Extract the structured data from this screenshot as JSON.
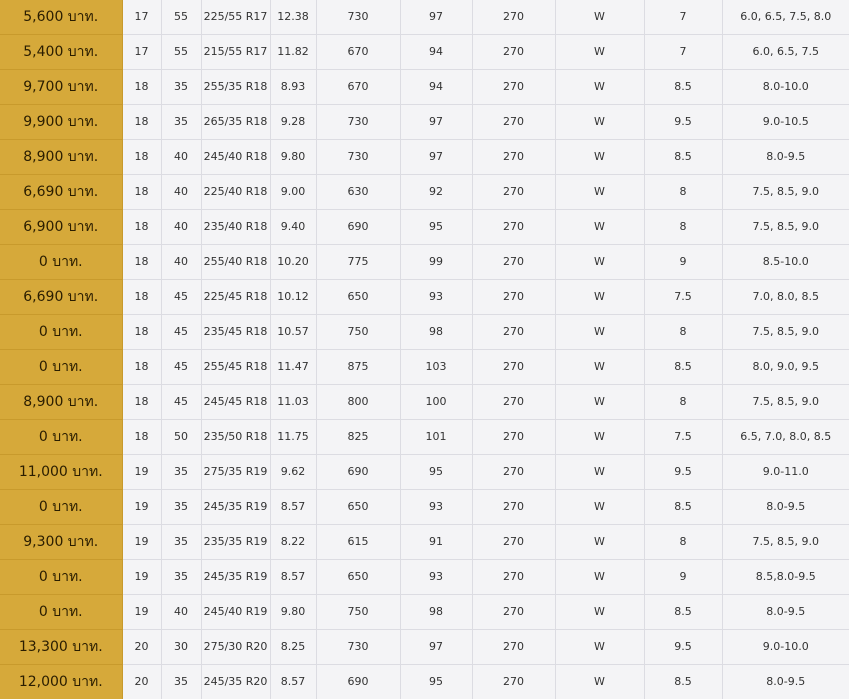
{
  "table": {
    "rows": [
      {
        "price": "5,600 บาท.",
        "rim": "17",
        "aspect": "55",
        "size": "225/55 R17",
        "weight": "12.38",
        "load_kg": "730",
        "load_index": "97",
        "speed_kmh": "270",
        "speed_symbol": "W",
        "rim_width": "7",
        "rim_range": "6.0, 6.5, 7.5, 8.0"
      },
      {
        "price": "5,400 บาท.",
        "rim": "17",
        "aspect": "55",
        "size": "215/55 R17",
        "weight": "11.82",
        "load_kg": "670",
        "load_index": "94",
        "speed_kmh": "270",
        "speed_symbol": "W",
        "rim_width": "7",
        "rim_range": "6.0, 6.5, 7.5"
      },
      {
        "price": "9,700 บาท.",
        "rim": "18",
        "aspect": "35",
        "size": "255/35 R18",
        "weight": "8.93",
        "load_kg": "670",
        "load_index": "94",
        "speed_kmh": "270",
        "speed_symbol": "W",
        "rim_width": "8.5",
        "rim_range": "8.0-10.0"
      },
      {
        "price": "9,900 บาท.",
        "rim": "18",
        "aspect": "35",
        "size": "265/35 R18",
        "weight": "9.28",
        "load_kg": "730",
        "load_index": "97",
        "speed_kmh": "270",
        "speed_symbol": "W",
        "rim_width": "9.5",
        "rim_range": "9.0-10.5"
      },
      {
        "price": "8,900 บาท.",
        "rim": "18",
        "aspect": "40",
        "size": "245/40 R18",
        "weight": "9.80",
        "load_kg": "730",
        "load_index": "97",
        "speed_kmh": "270",
        "speed_symbol": "W",
        "rim_width": "8.5",
        "rim_range": "8.0-9.5"
      },
      {
        "price": "6,690 บาท.",
        "rim": "18",
        "aspect": "40",
        "size": "225/40 R18",
        "weight": "9.00",
        "load_kg": "630",
        "load_index": "92",
        "speed_kmh": "270",
        "speed_symbol": "W",
        "rim_width": "8",
        "rim_range": "7.5, 8.5, 9.0"
      },
      {
        "price": "6,900 บาท.",
        "rim": "18",
        "aspect": "40",
        "size": "235/40 R18",
        "weight": "9.40",
        "load_kg": "690",
        "load_index": "95",
        "speed_kmh": "270",
        "speed_symbol": "W",
        "rim_width": "8",
        "rim_range": "7.5, 8.5, 9.0"
      },
      {
        "price": "0 บาท.",
        "rim": "18",
        "aspect": "40",
        "size": "255/40 R18",
        "weight": "10.20",
        "load_kg": "775",
        "load_index": "99",
        "speed_kmh": "270",
        "speed_symbol": "W",
        "rim_width": "9",
        "rim_range": "8.5-10.0"
      },
      {
        "price": "6,690 บาท.",
        "rim": "18",
        "aspect": "45",
        "size": "225/45 R18",
        "weight": "10.12",
        "load_kg": "650",
        "load_index": "93",
        "speed_kmh": "270",
        "speed_symbol": "W",
        "rim_width": "7.5",
        "rim_range": "7.0, 8.0, 8.5"
      },
      {
        "price": "0 บาท.",
        "rim": "18",
        "aspect": "45",
        "size": "235/45 R18",
        "weight": "10.57",
        "load_kg": "750",
        "load_index": "98",
        "speed_kmh": "270",
        "speed_symbol": "W",
        "rim_width": "8",
        "rim_range": "7.5, 8.5, 9.0"
      },
      {
        "price": "0 บาท.",
        "rim": "18",
        "aspect": "45",
        "size": "255/45 R18",
        "weight": "11.47",
        "load_kg": "875",
        "load_index": "103",
        "speed_kmh": "270",
        "speed_symbol": "W",
        "rim_width": "8.5",
        "rim_range": "8.0, 9.0, 9.5"
      },
      {
        "price": "8,900 บาท.",
        "rim": "18",
        "aspect": "45",
        "size": "245/45 R18",
        "weight": "11.03",
        "load_kg": "800",
        "load_index": "100",
        "speed_kmh": "270",
        "speed_symbol": "W",
        "rim_width": "8",
        "rim_range": "7.5, 8.5, 9.0"
      },
      {
        "price": "0 บาท.",
        "rim": "18",
        "aspect": "50",
        "size": "235/50 R18",
        "weight": "11.75",
        "load_kg": "825",
        "load_index": "101",
        "speed_kmh": "270",
        "speed_symbol": "W",
        "rim_width": "7.5",
        "rim_range": "6.5, 7.0, 8.0, 8.5"
      },
      {
        "price": "11,000 บาท.",
        "rim": "19",
        "aspect": "35",
        "size": "275/35 R19",
        "weight": "9.62",
        "load_kg": "690",
        "load_index": "95",
        "speed_kmh": "270",
        "speed_symbol": "W",
        "rim_width": "9.5",
        "rim_range": "9.0-11.0"
      },
      {
        "price": "0 บาท.",
        "rim": "19",
        "aspect": "35",
        "size": "245/35 R19",
        "weight": "8.57",
        "load_kg": "650",
        "load_index": "93",
        "speed_kmh": "270",
        "speed_symbol": "W",
        "rim_width": "8.5",
        "rim_range": "8.0-9.5"
      },
      {
        "price": "9,300 บาท.",
        "rim": "19",
        "aspect": "35",
        "size": "235/35 R19",
        "weight": "8.22",
        "load_kg": "615",
        "load_index": "91",
        "speed_kmh": "270",
        "speed_symbol": "W",
        "rim_width": "8",
        "rim_range": "7.5, 8.5, 9.0"
      },
      {
        "price": "0 บาท.",
        "rim": "19",
        "aspect": "35",
        "size": "245/35 R19",
        "weight": "8.57",
        "load_kg": "650",
        "load_index": "93",
        "speed_kmh": "270",
        "speed_symbol": "W",
        "rim_width": "9",
        "rim_range": "8.5,8.0-9.5"
      },
      {
        "price": "0 บาท.",
        "rim": "19",
        "aspect": "40",
        "size": "245/40 R19",
        "weight": "9.80",
        "load_kg": "750",
        "load_index": "98",
        "speed_kmh": "270",
        "speed_symbol": "W",
        "rim_width": "8.5",
        "rim_range": "8.0-9.5"
      },
      {
        "price": "13,300 บาท.",
        "rim": "20",
        "aspect": "30",
        "size": "275/30 R20",
        "weight": "8.25",
        "load_kg": "730",
        "load_index": "97",
        "speed_kmh": "270",
        "speed_symbol": "W",
        "rim_width": "9.5",
        "rim_range": "9.0-10.0"
      },
      {
        "price": "12,000 บาท.",
        "rim": "20",
        "aspect": "35",
        "size": "245/35 R20",
        "weight": "8.57",
        "load_kg": "690",
        "load_index": "95",
        "speed_kmh": "270",
        "speed_symbol": "W",
        "rim_width": "8.5",
        "rim_range": "8.0-9.5"
      }
    ]
  },
  "colors": {
    "price_bg": "#d6a93a",
    "table_bg": "#f4f4f6",
    "border": "#dcdce2"
  }
}
